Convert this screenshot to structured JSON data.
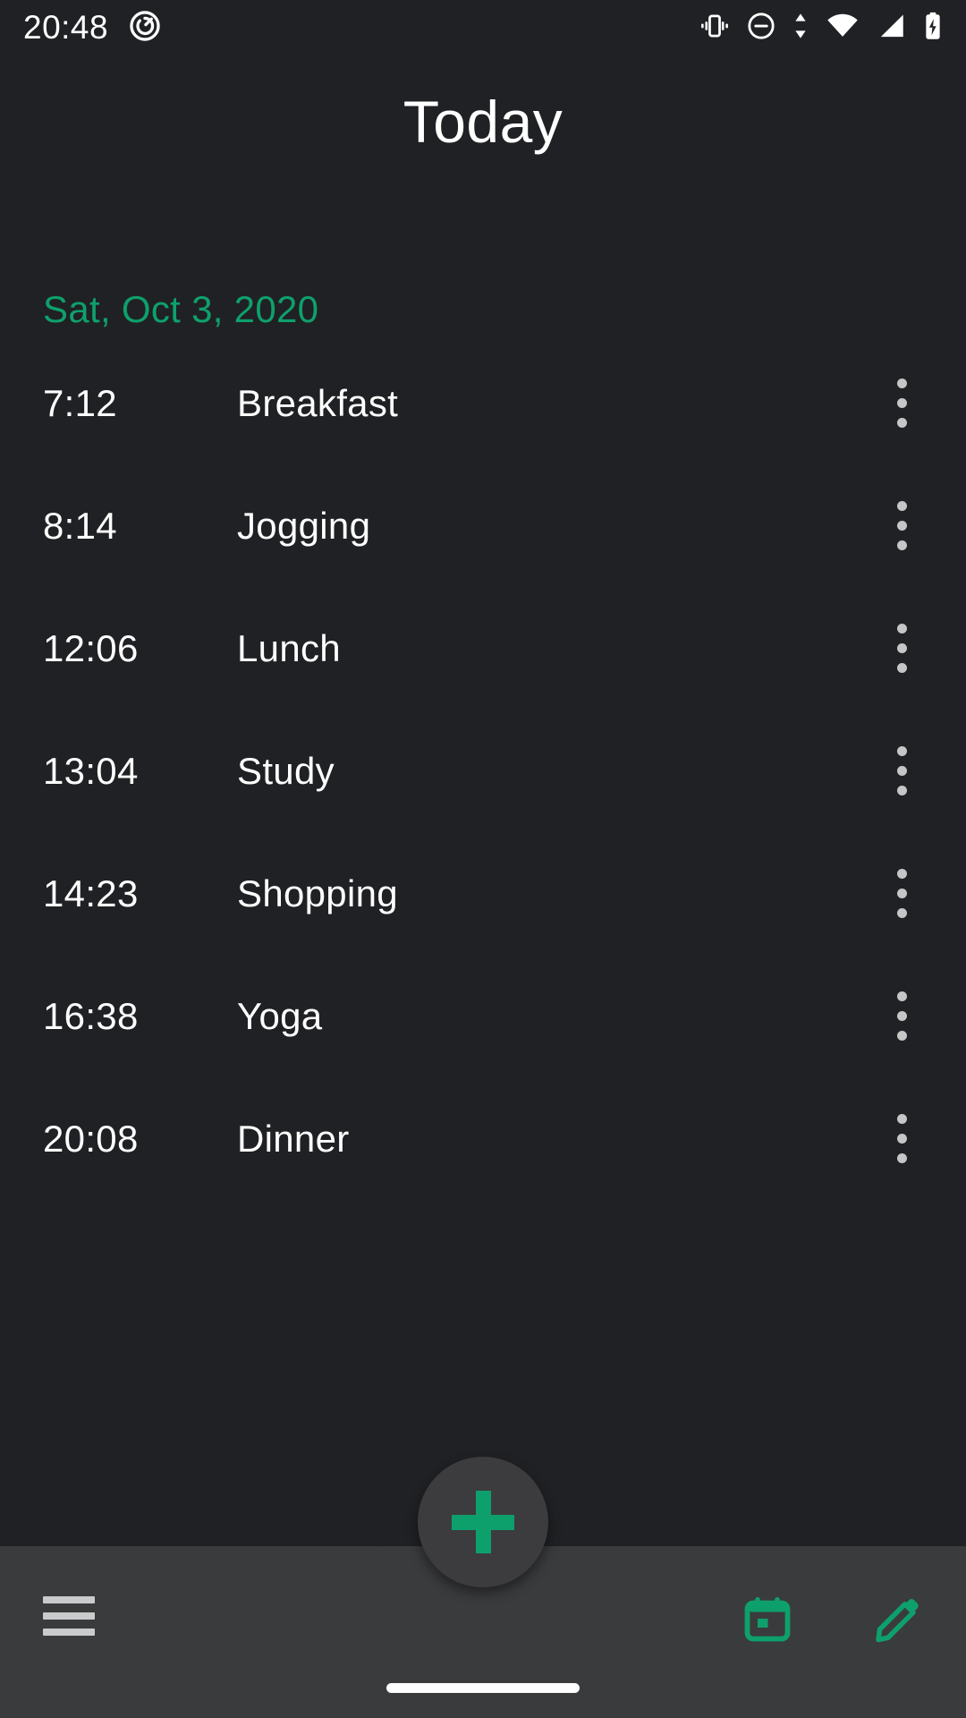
{
  "status_bar": {
    "time": "20:48",
    "left_icons": [
      {
        "name": "app-notification-icon",
        "label": "screen-record-badge"
      }
    ],
    "right_icons": [
      {
        "name": "vibrate-icon",
        "label": "Vibrate"
      },
      {
        "name": "do-not-disturb-icon",
        "label": "Do Not Disturb"
      },
      {
        "name": "data-transfer-icon",
        "label": "Data transfer"
      },
      {
        "name": "wifi-icon",
        "label": "Wi-Fi"
      },
      {
        "name": "cellular-signal-icon",
        "label": "Cellular signal"
      },
      {
        "name": "battery-charging-icon",
        "label": "Battery charging"
      }
    ]
  },
  "header": {
    "title": "Today"
  },
  "section": {
    "date_label": "Sat, Oct 3, 2020"
  },
  "entries": [
    {
      "time": "7:12",
      "title": "Breakfast",
      "menu": "overflow-menu"
    },
    {
      "time": "8:14",
      "title": "Jogging",
      "menu": "overflow-menu"
    },
    {
      "time": "12:06",
      "title": "Lunch",
      "menu": "overflow-menu"
    },
    {
      "time": "13:04",
      "title": "Study",
      "menu": "overflow-menu"
    },
    {
      "time": "14:23",
      "title": "Shopping",
      "menu": "overflow-menu"
    },
    {
      "time": "16:38",
      "title": "Yoga",
      "menu": "overflow-menu"
    },
    {
      "time": "20:08",
      "title": "Dinner",
      "menu": "overflow-menu"
    }
  ],
  "fab": {
    "icon": "plus-icon",
    "label": "Add entry"
  },
  "bottom_bar": {
    "menu_icon": "hamburger-menu-icon",
    "calendar_icon": "calendar-icon",
    "edit_icon": "pencil-edit-icon"
  },
  "system_nav": {
    "gesture_pill": "home-gesture-pill"
  },
  "colors": {
    "background": "#202124",
    "bottom_bar": "#3a3b3d",
    "accent_green": "#0EA06C",
    "text_primary": "#ffffff",
    "icon_muted": "#c4c7c5",
    "fab_surface": "#3c3c3e"
  }
}
